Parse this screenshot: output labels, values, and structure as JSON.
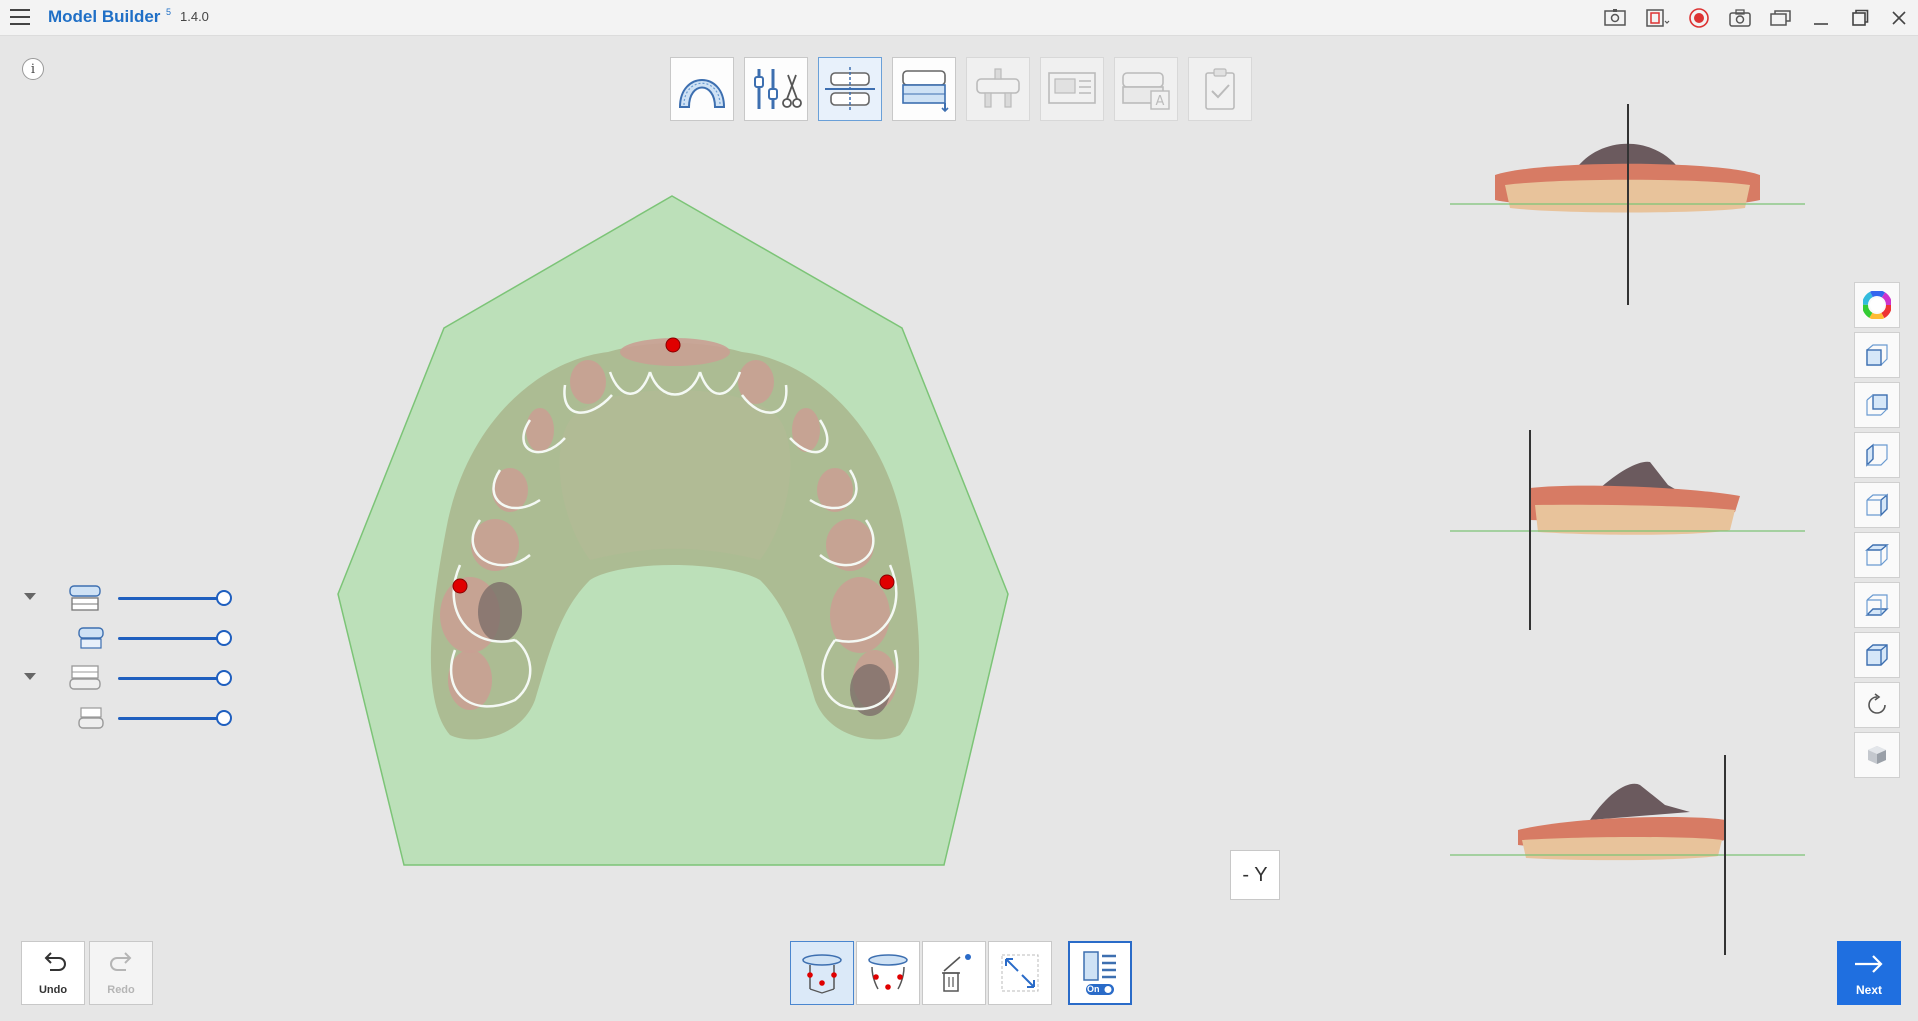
{
  "app": {
    "title": "Model Builder",
    "version": "1.4.0",
    "version_mark": "5"
  },
  "titlebar_icons": [
    "scan-image-icon",
    "window-record-icon",
    "record-icon",
    "camera-icon",
    "multi-window-icon",
    "minimize-icon",
    "restore-icon",
    "close-icon"
  ],
  "info": {
    "label": "i"
  },
  "workflow_steps": [
    {
      "name": "arch-step-icon",
      "state": "normal"
    },
    {
      "name": "trim-step-icon",
      "state": "normal"
    },
    {
      "name": "alignment-step-icon",
      "state": "active"
    },
    {
      "name": "base-step-icon",
      "state": "normal"
    },
    {
      "name": "pin-step-icon",
      "state": "disabled"
    },
    {
      "name": "label-step-icon",
      "state": "disabled"
    },
    {
      "name": "text-step-icon",
      "state": "disabled"
    },
    {
      "name": "check-step-icon",
      "state": "disabled"
    }
  ],
  "layers": [
    {
      "name": "upper-jaw-group",
      "expandable": true,
      "opacity": 1.0
    },
    {
      "name": "upper-jaw-model",
      "expandable": false,
      "opacity": 1.0
    },
    {
      "name": "lower-jaw-group",
      "expandable": true,
      "opacity": 1.0
    },
    {
      "name": "lower-jaw-model",
      "expandable": false,
      "opacity": 1.0
    }
  ],
  "view_tools": [
    "color-wheel-icon",
    "front-view-icon",
    "back-view-icon",
    "left-view-icon",
    "right-view-icon",
    "top-view-icon",
    "bottom-view-icon",
    "iso-view-icon",
    "reset-rotation-icon",
    "cube-icon"
  ],
  "axis": {
    "label": "- Y"
  },
  "history": {
    "undo_label": "Undo",
    "redo_label": "Redo"
  },
  "bottom_tools": [
    {
      "name": "three-point-plane-tool",
      "state": "active"
    },
    {
      "name": "plane-points-tool",
      "state": "normal"
    },
    {
      "name": "delete-points-tool",
      "state": "normal"
    },
    {
      "name": "resize-tool",
      "state": "normal"
    },
    {
      "name": "panel-toggle-tool",
      "state": "toggled",
      "toggle_text": "On"
    }
  ],
  "next": {
    "label": "Next"
  },
  "colors": {
    "accent": "#1f6fc6",
    "next_bg": "#1f6fe0",
    "plane_fill": "#b4deb0",
    "marker_red": "#e00000"
  }
}
